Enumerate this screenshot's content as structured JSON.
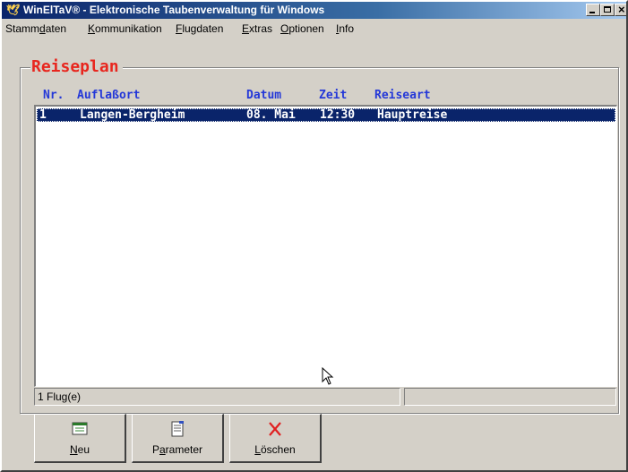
{
  "window": {
    "title": "WinElTaV® - Elektronische Taubenverwaltung für Windows"
  },
  "menu": [
    {
      "pre": "Stamm",
      "acc": "d",
      "post": "aten"
    },
    {
      "pre": "",
      "acc": "K",
      "post": "ommunikation"
    },
    {
      "pre": "",
      "acc": "F",
      "post": "lugdaten"
    },
    {
      "pre": "",
      "acc": "E",
      "post": "xtras"
    },
    {
      "pre": "",
      "acc": "O",
      "post": "ptionen"
    },
    {
      "pre": "",
      "acc": "I",
      "post": "nfo"
    }
  ],
  "group": {
    "title": "Reiseplan"
  },
  "table": {
    "columns": [
      "Nr.",
      "Auflaßort",
      "Datum",
      "Zeit",
      "Reiseart"
    ],
    "rows": [
      {
        "nr": "1",
        "ort": "Langen-Bergheim",
        "datum": "08. Mai",
        "zeit": "12:30",
        "art": "Hauptreise",
        "selected": true
      }
    ]
  },
  "status": {
    "left": "1 Flug(e)",
    "right": ""
  },
  "buttons": {
    "neu": {
      "pre": "",
      "acc": "N",
      "post": "eu",
      "icon": "new-document-icon"
    },
    "parameter": {
      "pre": "P",
      "acc": "a",
      "post": "rameter",
      "icon": "parameter-document-icon"
    },
    "loeschen": {
      "pre": "",
      "acc": "L",
      "post": "öschen",
      "icon": "delete-x-icon"
    }
  },
  "colors": {
    "title_text": "#e8261e",
    "header_text": "#2438d8",
    "selection": "#0a246a",
    "delete_icon": "#e02020"
  }
}
